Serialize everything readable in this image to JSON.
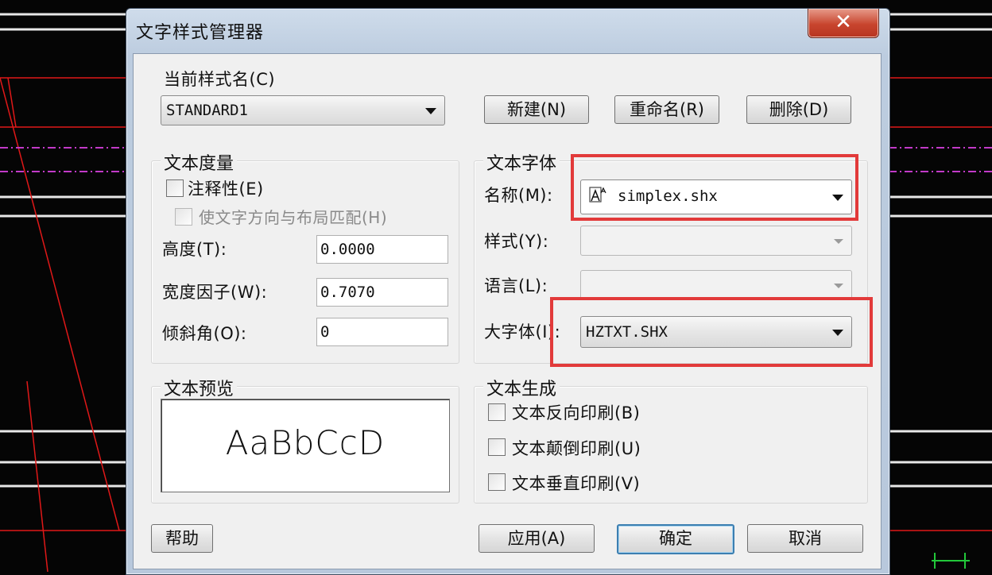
{
  "window": {
    "title": "文字样式管理器",
    "close_label": "✕"
  },
  "current_style": {
    "label": "当前样式名(C)",
    "value": "STANDARD1"
  },
  "buttons": {
    "new": "新建(N)",
    "rename": "重命名(R)",
    "delete": "删除(D)",
    "help": "帮助",
    "apply": "应用(A)",
    "ok": "确定",
    "cancel": "取消"
  },
  "text_measure": {
    "title": "文本度量",
    "annotative_label": "注释性(E)",
    "annotative_checked": false,
    "match_layout_label": "使文字方向与布局匹配(H)",
    "match_layout_enabled": false,
    "height_label": "高度(T):",
    "height_value": "0.0000",
    "width_factor_label": "宽度因子(W):",
    "width_factor_value": "0.7070",
    "oblique_label": "倾斜角(O):",
    "oblique_value": "0"
  },
  "text_font": {
    "title": "文本字体",
    "name_label": "名称(M):",
    "name_value": "simplex.shx",
    "name_icon": "shx-font-icon",
    "style_label": "样式(Y):",
    "style_value": "",
    "language_label": "语言(L):",
    "language_value": "",
    "bigfont_label": "大字体(I):",
    "bigfont_value": "HZTXT.SHX"
  },
  "text_preview": {
    "title": "文本预览",
    "sample": "AaBbCcD"
  },
  "text_generation": {
    "title": "文本生成",
    "backwards_label": "文本反向印刷(B)",
    "upside_down_label": "文本颠倒印刷(U)",
    "vertical_label": "文本垂直印刷(V)"
  },
  "colors": {
    "highlight": "#e23a3a",
    "cad_background": "#050505",
    "cad_red_line": "#e01818",
    "cad_magenta_line": "#c23ac8"
  }
}
